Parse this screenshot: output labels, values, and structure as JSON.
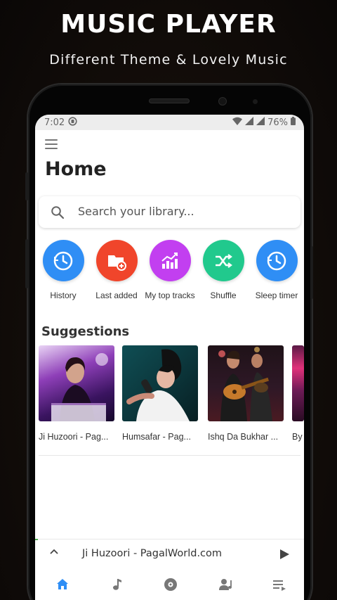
{
  "promo": {
    "title": "MUSIC PLAYER",
    "subtitle": "Different Theme & Lovely Music"
  },
  "status": {
    "time": "7:02",
    "battery": "76%"
  },
  "header": {
    "title": "Home"
  },
  "search": {
    "placeholder": "Search your library..."
  },
  "quick_actions": [
    {
      "label": "History",
      "icon": "history-clock-icon",
      "color": "#2f8ef5"
    },
    {
      "label": "Last added",
      "icon": "folder-add-icon",
      "color": "#f0452b"
    },
    {
      "label": "My top tracks",
      "icon": "trending-chart-icon",
      "color": "#c23ff0"
    },
    {
      "label": "Shuffle",
      "icon": "shuffle-icon",
      "color": "#21c98d"
    },
    {
      "label": "Sleep timer",
      "icon": "sleep-timer-icon",
      "color": "#2f8ef5"
    }
  ],
  "suggestions": {
    "title": "Suggestions",
    "items": [
      {
        "label": "Ji Huzoori - Pag..."
      },
      {
        "label": "Humsafar - Pag..."
      },
      {
        "label": "Ishq Da Bukhar ..."
      },
      {
        "label": "By"
      }
    ]
  },
  "mini_player": {
    "title": "Ji Huzoori - PagalWorld.com",
    "progress": 0.01
  },
  "nav": {
    "items": [
      {
        "icon": "home-icon",
        "active": true
      },
      {
        "icon": "music-note-icon",
        "active": false
      },
      {
        "icon": "album-disc-icon",
        "active": false
      },
      {
        "icon": "artist-icon",
        "active": false
      },
      {
        "icon": "playlist-icon",
        "active": false
      }
    ]
  },
  "colors": {
    "accent": "#2f8ef5",
    "nav_active": "#2f8ef5",
    "nav_inactive": "#777777"
  }
}
